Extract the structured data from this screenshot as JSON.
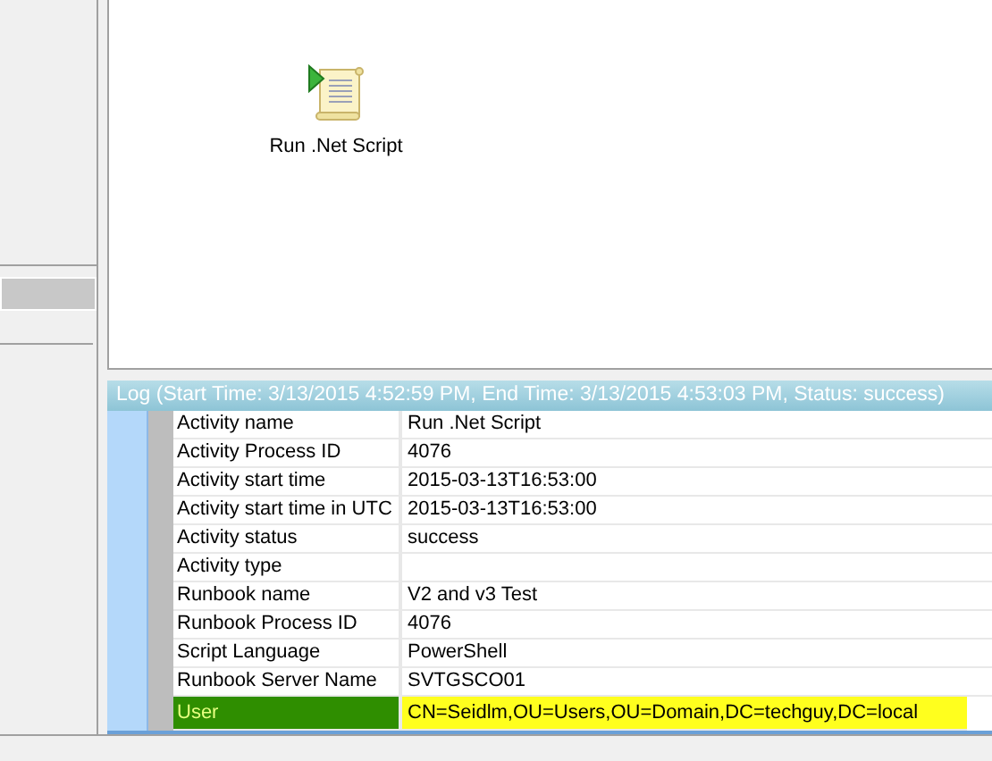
{
  "canvas": {
    "activities": [
      {
        "label": "Run .Net Script"
      }
    ]
  },
  "sidebar": {
    "items": [
      {
        "selected": true
      }
    ]
  },
  "log": {
    "title": "Log  (Start Time: 3/13/2015 4:52:59 PM, End Time: 3/13/2015 4:53:03 PM, Status: success)",
    "rows": [
      {
        "name": "Activity name",
        "value": "Run .Net Script",
        "selected": false,
        "highlighted": false
      },
      {
        "name": "Activity Process ID",
        "value": "4076",
        "selected": false,
        "highlighted": false
      },
      {
        "name": "Activity start time",
        "value": "2015-03-13T16:53:00",
        "selected": false,
        "highlighted": false
      },
      {
        "name": "Activity start time in UTC",
        "value": "2015-03-13T16:53:00",
        "selected": false,
        "highlighted": false
      },
      {
        "name": "Activity status",
        "value": "success",
        "selected": false,
        "highlighted": false
      },
      {
        "name": "Activity type",
        "value": "",
        "selected": false,
        "highlighted": false
      },
      {
        "name": "Runbook name",
        "value": "V2 and v3 Test",
        "selected": false,
        "highlighted": false
      },
      {
        "name": "Runbook Process ID",
        "value": "4076",
        "selected": false,
        "highlighted": false
      },
      {
        "name": "Script Language",
        "value": "PowerShell",
        "selected": false,
        "highlighted": false
      },
      {
        "name": "Runbook Server Name",
        "value": "SVTGSCO01",
        "selected": false,
        "highlighted": false
      },
      {
        "name": "User",
        "value": "CN=Seidlm,OU=Users,OU=Domain,DC=techguy,DC=local",
        "selected": true,
        "highlighted": true
      }
    ]
  }
}
